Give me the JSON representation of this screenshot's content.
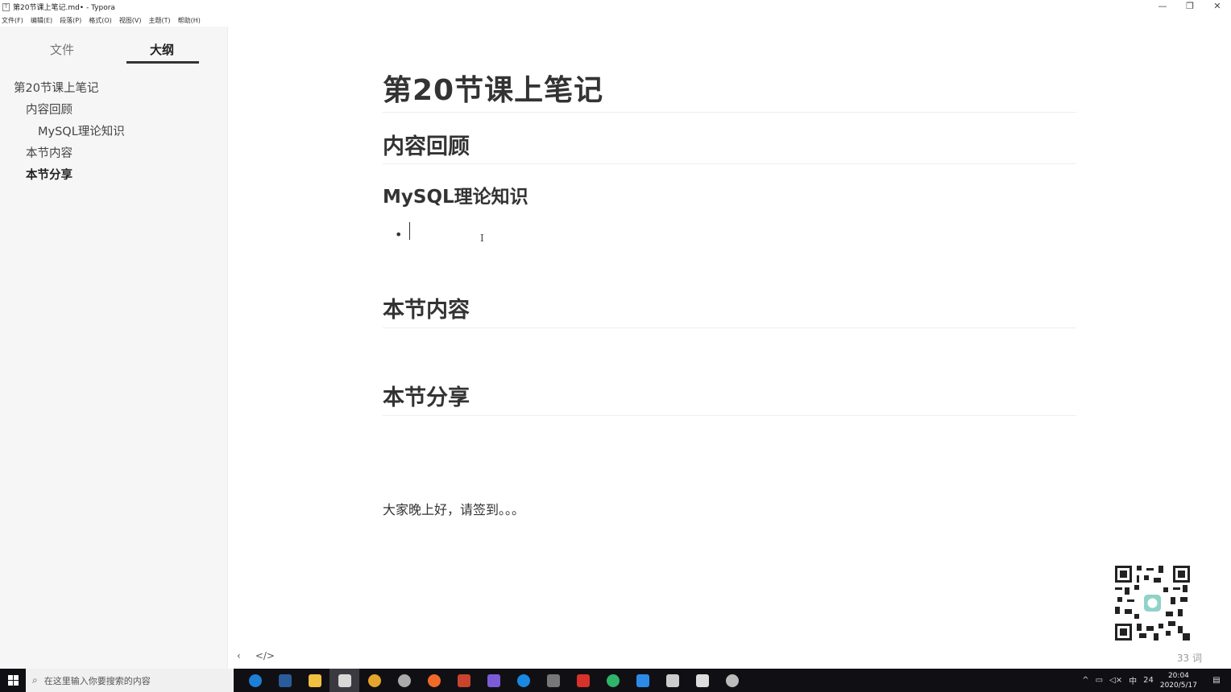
{
  "window": {
    "title": "第20节课上笔记.md• - Typora",
    "controls": [
      "—",
      "❐",
      "✕"
    ]
  },
  "menu": [
    "文件(F)",
    "编辑(E)",
    "段落(P)",
    "格式(O)",
    "视图(V)",
    "主题(T)",
    "帮助(H)"
  ],
  "sidebar": {
    "tabs": [
      "文件",
      "大纲"
    ],
    "active_tab": "大纲",
    "outline": [
      {
        "label": "第20节课上笔记",
        "level": 1
      },
      {
        "label": "内容回顾",
        "level": 2
      },
      {
        "label": "MySQL理论知识",
        "level": 3
      },
      {
        "label": "本节内容",
        "level": 2
      },
      {
        "label": "本节分享",
        "level": 2,
        "active": true
      }
    ]
  },
  "document": {
    "h1": "第20节课上笔记",
    "h2_review": "内容回顾",
    "h3_mysql": "MySQL理论知识",
    "bullet": "•",
    "h2_content": "本节内容",
    "h2_share": "本节分享",
    "paragraph": "大家晚上好，请签到。。。"
  },
  "footer": {
    "word_count": "33 词",
    "back_icon": "‹",
    "source_icon": "</>"
  },
  "taskbar": {
    "search_placeholder": "在这里输入你要搜索的内容",
    "clock_time": "20:04",
    "clock_date": "2020/5/17",
    "tray_ime": "中",
    "tray_num": "24",
    "apps": [
      {
        "name": "edge-icon",
        "color": "#1e7fd6"
      },
      {
        "name": "steam-icon",
        "color": "#2a5b9a"
      },
      {
        "name": "explorer-icon",
        "color": "#f0c040"
      },
      {
        "name": "typora-icon",
        "color": "#d8d8d8"
      },
      {
        "name": "chrome-icon",
        "color": "#e4a52b"
      },
      {
        "name": "obs-icon",
        "color": "#aaaaaa"
      },
      {
        "name": "postman-icon",
        "color": "#f06a2a"
      },
      {
        "name": "fiddler-icon",
        "color": "#c8442c"
      },
      {
        "name": "goland-icon",
        "color": "#7b5cd6"
      },
      {
        "name": "browser-icon",
        "color": "#1a88e0"
      },
      {
        "name": "terminal-icon",
        "color": "#777777"
      },
      {
        "name": "pdf-icon",
        "color": "#d8322a"
      },
      {
        "name": "feishu-icon",
        "color": "#2fb56a"
      },
      {
        "name": "vscode-icon",
        "color": "#2c8ae8"
      },
      {
        "name": "card-icon",
        "color": "#cccccc"
      },
      {
        "name": "calculator-icon",
        "color": "#dddddd"
      },
      {
        "name": "tool-icon",
        "color": "#bbbbbb"
      }
    ]
  }
}
